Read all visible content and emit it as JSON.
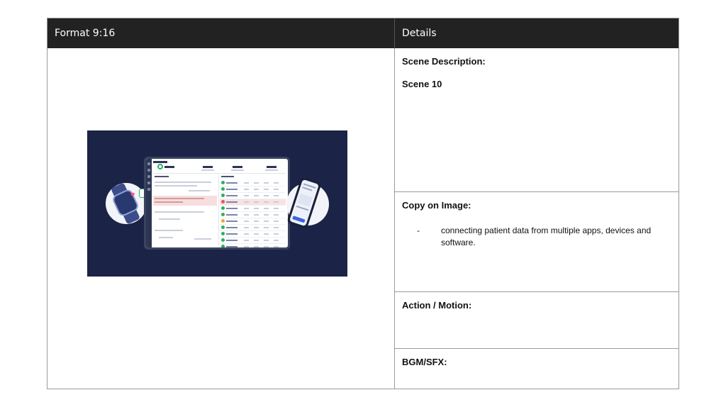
{
  "table": {
    "header_left": "Format 9:16",
    "header_right": "Details"
  },
  "scene": {
    "description_label": "Scene Description:",
    "scene_number": "Scene 10"
  },
  "copy": {
    "label": "Copy on Image:",
    "bullet": "-",
    "text": "connecting patient data from multiple apps, devices and software."
  },
  "action": {
    "label": "Action / Motion:"
  },
  "bgm": {
    "label": "BGM/SFX:"
  },
  "illustration": {
    "background_color": "#1b2346",
    "accent_green": "#2eae62",
    "accent_pink": "#f6dede",
    "icons": [
      "smartwatch-icon",
      "heart-icon",
      "smartphone-icon",
      "dashboard-tablet"
    ]
  }
}
